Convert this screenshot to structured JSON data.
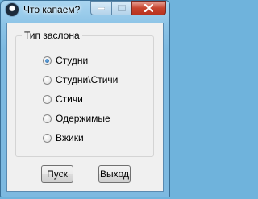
{
  "window": {
    "title": "Что капаем?"
  },
  "group": {
    "title": "Тип заслона",
    "options": [
      {
        "label": "Студни",
        "checked": true
      },
      {
        "label": "Студни\\Стичи",
        "checked": false
      },
      {
        "label": "Стичи",
        "checked": false
      },
      {
        "label": "Одержимые",
        "checked": false
      },
      {
        "label": "Вжики",
        "checked": false
      }
    ]
  },
  "buttons": {
    "start": "Пуск",
    "exit": "Выход"
  }
}
